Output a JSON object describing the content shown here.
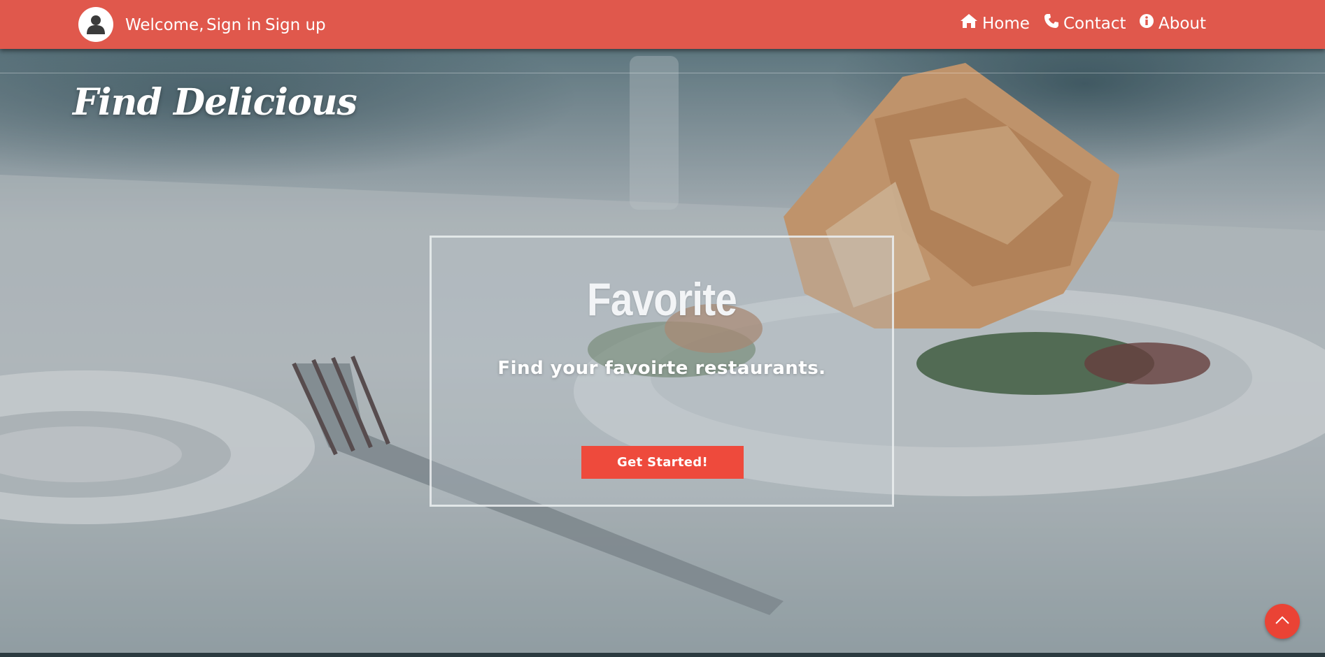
{
  "navbar": {
    "welcome": "Welcome,",
    "sign_in": "Sign in",
    "sign_up": "Sign up",
    "home": "Home",
    "contact": "Contact",
    "about": "About",
    "bg_color": "#e0584c"
  },
  "brand": {
    "title": "Find Delicious"
  },
  "hero": {
    "title": "Favorite",
    "subtitle": "Find your favoirte restaurants.",
    "button_label": "Get Started!",
    "button_color": "#ee4a3c"
  },
  "icons": {
    "avatar": "user-icon",
    "home": "home-icon",
    "contact": "phone-icon",
    "about": "info-icon",
    "scroll_top": "chevron-up-icon"
  }
}
